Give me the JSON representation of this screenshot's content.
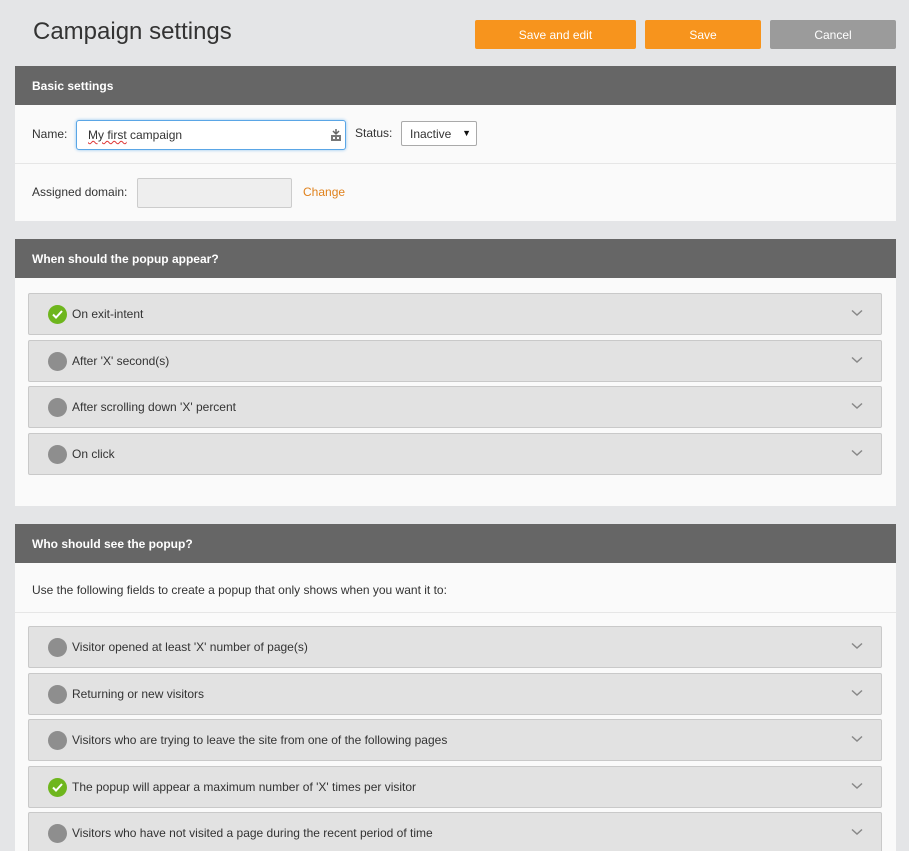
{
  "header": {
    "title": "Campaign settings",
    "save_and_edit": "Save and edit",
    "save": "Save",
    "cancel": "Cancel"
  },
  "basic": {
    "heading": "Basic settings",
    "name_label": "Name:",
    "name_value_underlined": "My first",
    "name_value_rest": " campaign",
    "status_label": "Status:",
    "status_value": "Inactive",
    "domain_label": "Assigned domain:",
    "domain_value": "",
    "change_link": "Change"
  },
  "when": {
    "heading": "When should the popup appear?",
    "items": [
      {
        "label": "On exit-intent",
        "checked": true
      },
      {
        "label": "After 'X' second(s)",
        "checked": false
      },
      {
        "label": "After scrolling down 'X' percent",
        "checked": false
      },
      {
        "label": "On click",
        "checked": false
      }
    ]
  },
  "who": {
    "heading": "Who should see the popup?",
    "intro": "Use the following fields to create a popup that only shows when you want it to:",
    "items": [
      {
        "label": "Visitor opened at least 'X' number of page(s)",
        "checked": false
      },
      {
        "label": "Returning or new visitors",
        "checked": false
      },
      {
        "label": "Visitors who are trying to leave the site from one of the following pages",
        "checked": false
      },
      {
        "label": "The popup will appear a maximum number of 'X' times per visitor",
        "checked": true
      },
      {
        "label": "Visitors who have not visited a page during the recent period of time",
        "checked": false
      }
    ]
  },
  "colors": {
    "accent": "#f7941d",
    "check_green": "#6eb61d",
    "header_bar": "#666666",
    "link": "#e0811b"
  }
}
